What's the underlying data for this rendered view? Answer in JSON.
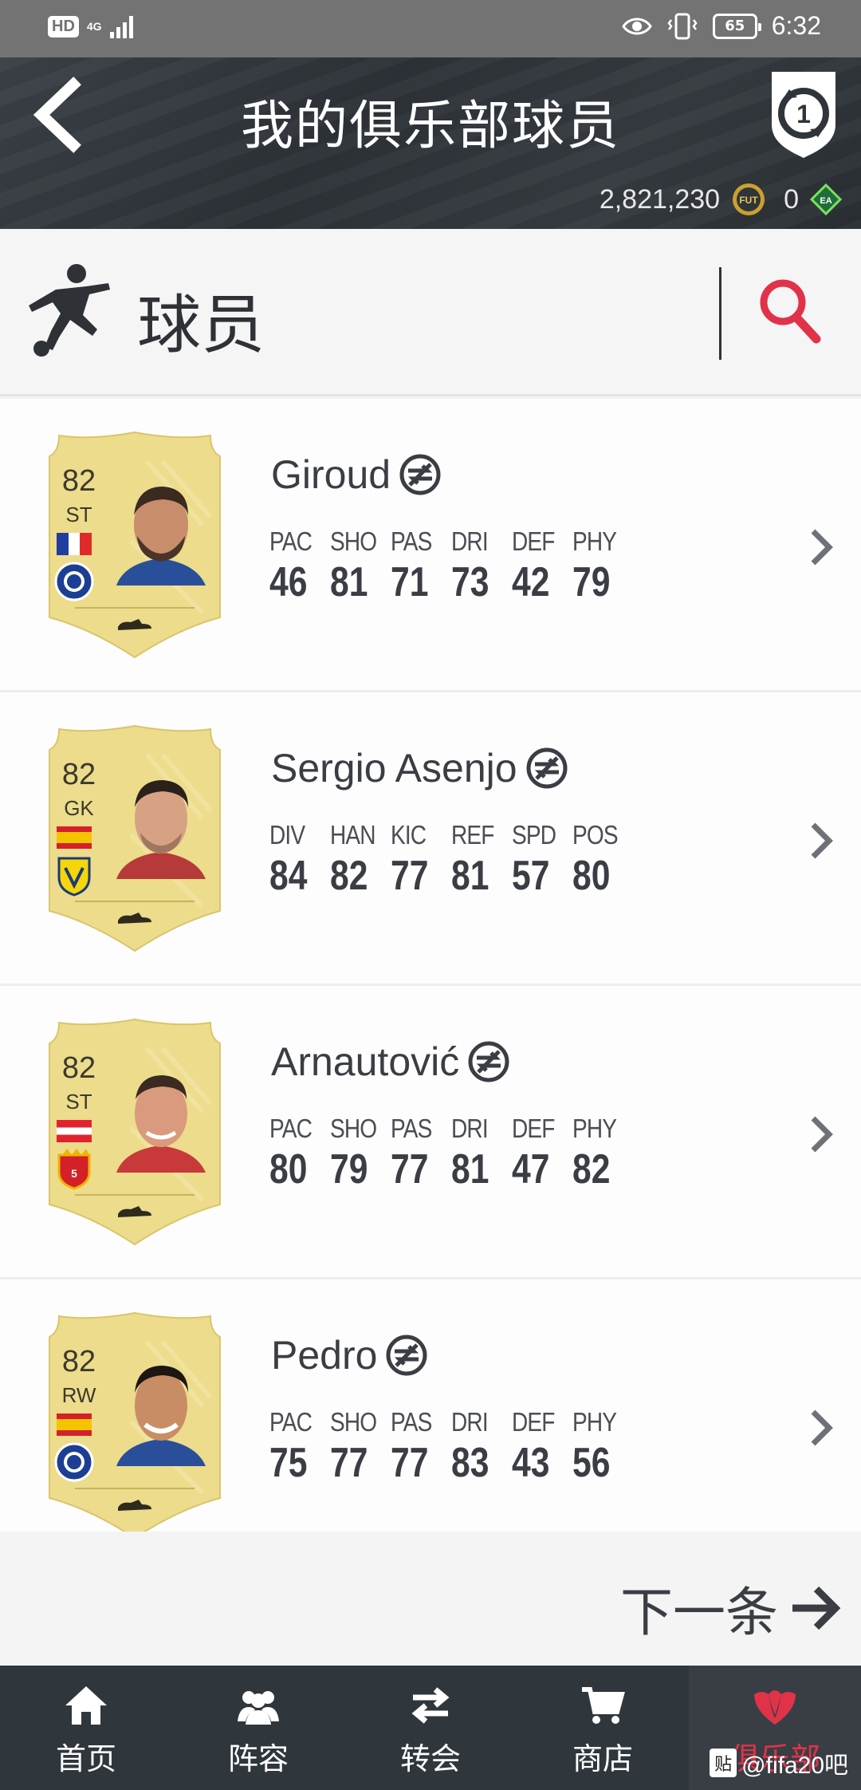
{
  "status_bar": {
    "hd": "HD",
    "network": "4G",
    "battery": "65",
    "time": "6:32"
  },
  "header": {
    "title": "我的俱乐部球员",
    "coins": "2,821,230",
    "coin_icon_label": "FUT",
    "points": "0"
  },
  "section": {
    "title": "球员"
  },
  "players": [
    {
      "name": "Giroud",
      "rating": "82",
      "position": "ST",
      "stats": [
        {
          "label": "PAC",
          "value": "46"
        },
        {
          "label": "SHO",
          "value": "81"
        },
        {
          "label": "PAS",
          "value": "71"
        },
        {
          "label": "DRI",
          "value": "73"
        },
        {
          "label": "DEF",
          "value": "42"
        },
        {
          "label": "PHY",
          "value": "79"
        }
      ]
    },
    {
      "name": "Sergio Asenjo",
      "rating": "82",
      "position": "GK",
      "stats": [
        {
          "label": "DIV",
          "value": "84"
        },
        {
          "label": "HAN",
          "value": "82"
        },
        {
          "label": "KIC",
          "value": "77"
        },
        {
          "label": "REF",
          "value": "81"
        },
        {
          "label": "SPD",
          "value": "57"
        },
        {
          "label": "POS",
          "value": "80"
        }
      ]
    },
    {
      "name": "Arnautović",
      "rating": "82",
      "position": "ST",
      "stats": [
        {
          "label": "PAC",
          "value": "80"
        },
        {
          "label": "SHO",
          "value": "79"
        },
        {
          "label": "PAS",
          "value": "77"
        },
        {
          "label": "DRI",
          "value": "81"
        },
        {
          "label": "DEF",
          "value": "47"
        },
        {
          "label": "PHY",
          "value": "82"
        }
      ]
    },
    {
      "name": "Pedro",
      "rating": "82",
      "position": "RW",
      "stats": [
        {
          "label": "PAC",
          "value": "75"
        },
        {
          "label": "SHO",
          "value": "77"
        },
        {
          "label": "PAS",
          "value": "77"
        },
        {
          "label": "DRI",
          "value": "83"
        },
        {
          "label": "DEF",
          "value": "43"
        },
        {
          "label": "PHY",
          "value": "56"
        }
      ]
    }
  ],
  "next": {
    "label": "下一条"
  },
  "nav": {
    "items": [
      {
        "label": "首页"
      },
      {
        "label": "阵容"
      },
      {
        "label": "转会"
      },
      {
        "label": "商店"
      },
      {
        "label": "俱乐部"
      }
    ],
    "active_color": "#e0334a"
  },
  "watermark": {
    "badge": "贴",
    "text": "@fifa20吧"
  },
  "colors": {
    "header_bg": "#2f353a",
    "card_gold": "#ecdc8c",
    "accent_red": "#e0334a"
  }
}
